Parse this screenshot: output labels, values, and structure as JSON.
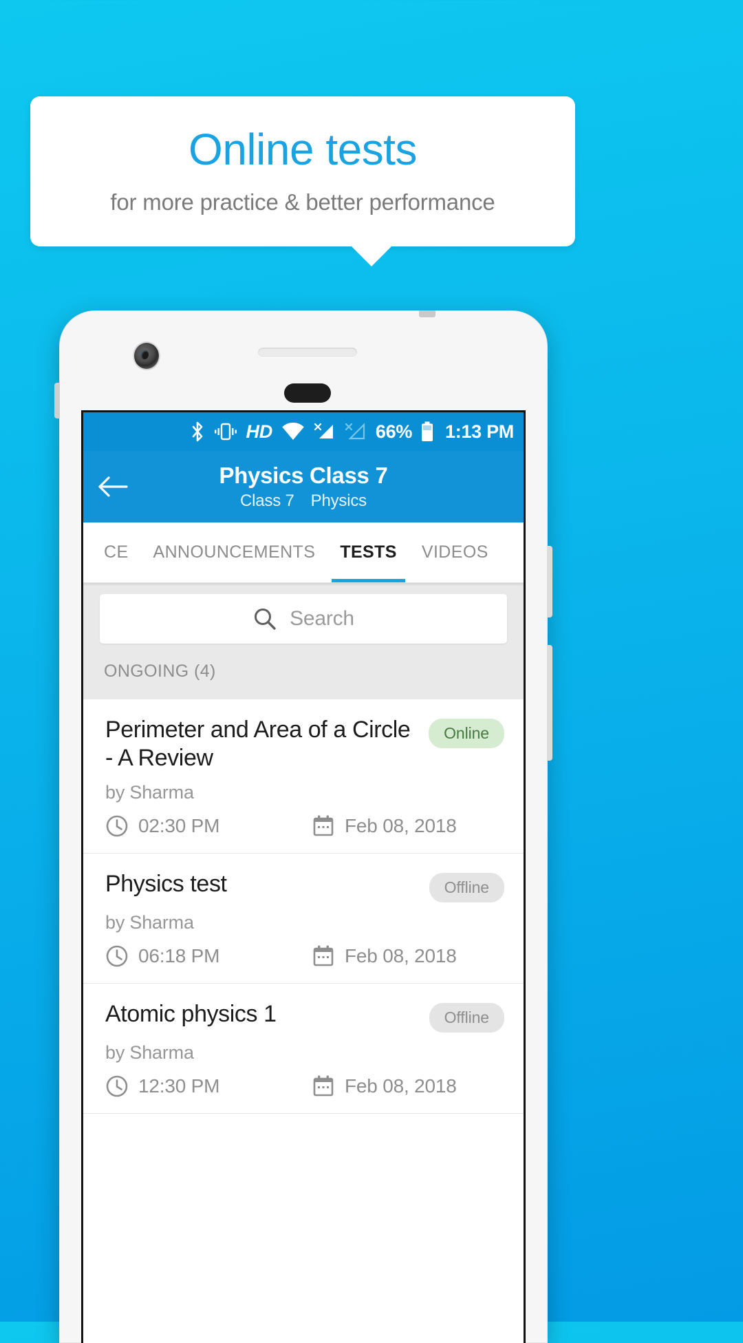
{
  "promo": {
    "title": "Online tests",
    "subtitle": "for more practice & better performance",
    "title_color": "#1aa3e0",
    "subtitle_color": "#7a7a7a",
    "card_bg": "#ffffff",
    "background_color": "#0bb8ec"
  },
  "statusbar": {
    "icons": [
      "bluetooth-icon",
      "vibrate-icon",
      "hd-icon",
      "wifi-icon",
      "signal-sim1-icon",
      "signal-sim2-icon"
    ],
    "hd_label": "HD",
    "battery_percent": "66%",
    "time": "1:13 PM",
    "background": "#0b8fd4"
  },
  "appbar": {
    "back_icon": "arrow-left-icon",
    "title": "Physics Class 7",
    "subtitle_class": "Class 7",
    "subtitle_subject": "Physics",
    "background": "#1293d7"
  },
  "tabs": {
    "items": [
      {
        "label": "CE",
        "active": false
      },
      {
        "label": "ANNOUNCEMENTS",
        "active": false
      },
      {
        "label": "TESTS",
        "active": true
      },
      {
        "label": "VIDEOS",
        "active": false
      }
    ],
    "indicator_color": "#1aa3e0"
  },
  "search": {
    "icon": "search-icon",
    "placeholder": "Search",
    "value": ""
  },
  "section": {
    "header": "ONGOING (4)"
  },
  "tests": [
    {
      "title": "Perimeter and Area of a Circle - A Review",
      "badge": "Online",
      "badge_type": "online",
      "author": "by Sharma",
      "time_icon": "clock-icon",
      "time": "02:30 PM",
      "date_icon": "calendar-icon",
      "date": "Feb 08, 2018"
    },
    {
      "title": "Physics test",
      "badge": "Offline",
      "badge_type": "offline",
      "author": "by Sharma",
      "time_icon": "clock-icon",
      "time": "06:18 PM",
      "date_icon": "calendar-icon",
      "date": "Feb 08, 2018"
    },
    {
      "title": "Atomic physics 1",
      "badge": "Offline",
      "badge_type": "offline",
      "author": "by Sharma",
      "time_icon": "clock-icon",
      "time": "12:30 PM",
      "date_icon": "calendar-icon",
      "date": "Feb 08, 2018"
    }
  ]
}
